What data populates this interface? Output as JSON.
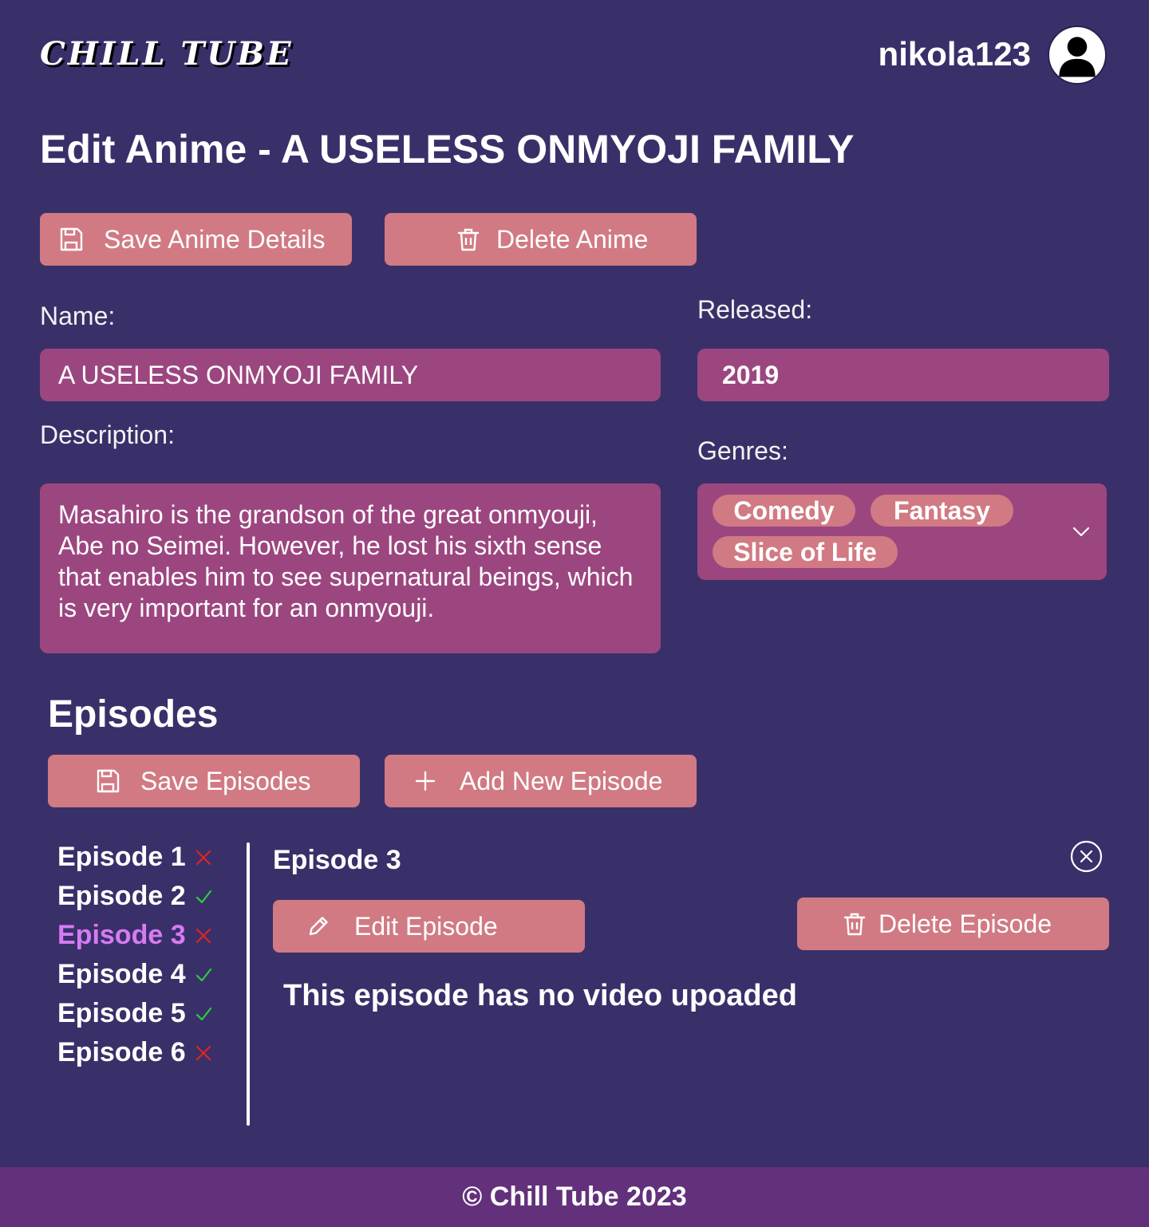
{
  "header": {
    "logo": "CHILL TUBE",
    "username": "nikola123"
  },
  "page": {
    "title": "Edit Anime - A USELESS ONMYOJI FAMILY"
  },
  "anime_actions": {
    "save_label": "Save Anime Details",
    "delete_label": "Delete Anime"
  },
  "form": {
    "name_label": "Name:",
    "name_value": "A USELESS ONMYOJI FAMILY",
    "released_label": "Released:",
    "released_value": "2019",
    "description_label": "Description:",
    "description_value": "Masahiro is the grandson of the great onmyouji, Abe no Seimei. However, he lost his sixth sense that enables him to see supernatural beings, which is very important for an onmyouji.",
    "genres_label": "Genres:",
    "genres": [
      "Comedy",
      "Fantasy",
      "Slice of Life"
    ]
  },
  "episodes": {
    "title": "Episodes",
    "save_label": "Save Episodes",
    "add_label": "Add New Episode",
    "list": [
      {
        "label": "Episode 1",
        "has_video": false
      },
      {
        "label": "Episode 2",
        "has_video": true
      },
      {
        "label": "Episode 3",
        "has_video": false,
        "selected": true
      },
      {
        "label": "Episode 4",
        "has_video": true
      },
      {
        "label": "Episode 5",
        "has_video": true
      },
      {
        "label": "Episode 6",
        "has_video": false
      }
    ],
    "detail": {
      "heading": "Episode 3",
      "edit_label": "Edit Episode",
      "delete_label": "Delete Episode",
      "message": "This episode has no video upoaded"
    }
  },
  "footer": {
    "text": "© Chill Tube 2023"
  },
  "colors": {
    "background": "#39306a",
    "button": "#d17a83",
    "field": "#9c4680",
    "footer": "#63317b",
    "selected_episode": "#d77bf2",
    "check": "#2ecc40",
    "cross": "#e02424"
  },
  "icons": {
    "save": "floppy-disk-icon",
    "delete": "trash-icon",
    "add": "plus-icon",
    "edit": "pencil-icon",
    "close": "close-circle-icon",
    "dropdown": "chevron-down-icon",
    "has_video": "check-icon",
    "no_video": "x-icon"
  }
}
